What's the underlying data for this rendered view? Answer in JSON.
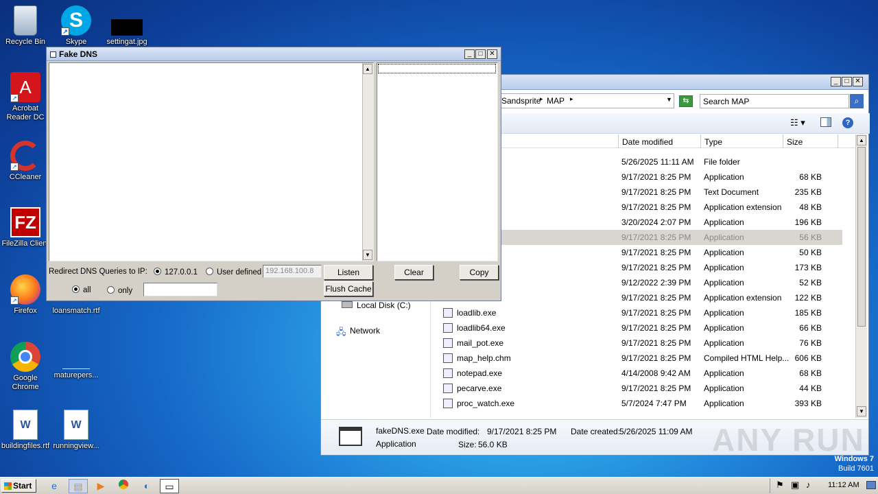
{
  "desktop_icons": [
    {
      "label": "Recycle Bin",
      "icon": "recycle-bin-icon"
    },
    {
      "label": "Skype",
      "icon": "skype-icon"
    },
    {
      "label": "settingat.jpg",
      "icon": "image-file-icon"
    },
    {
      "label": "Acrobat Reader DC",
      "icon": "acrobat-icon"
    },
    {
      "label": "CCleaner",
      "icon": "ccleaner-icon"
    },
    {
      "label": "FileZilla Client",
      "icon": "filezilla-icon"
    },
    {
      "label": "Firefox",
      "icon": "firefox-icon"
    },
    {
      "label": "loansmatch.rtf",
      "icon": "rtf-file-icon"
    },
    {
      "label": "Google Chrome",
      "icon": "chrome-icon"
    },
    {
      "label": "maturepers...",
      "icon": "file-icon"
    },
    {
      "label": "buildingfiles.rtf",
      "icon": "word-file-icon"
    },
    {
      "label": "runningview...",
      "icon": "word-file-icon"
    }
  ],
  "fake_dns": {
    "title": "Fake DNS",
    "redirect_label": "Redirect DNS Queries to IP:",
    "radio_localhost": "127.0.0.1",
    "radio_user": "User defined",
    "ip_placeholder": "192.168.100.8",
    "listen": "Listen",
    "clear": "Clear",
    "copy": "Copy",
    "flush": "Flush Cache",
    "radio_all": "all",
    "radio_only": "only",
    "only_value": ""
  },
  "explorer": {
    "breadcrumb_1": "Sandsprite",
    "breadcrumb_2": "MAP",
    "search_placeholder": "Search MAP",
    "columns": {
      "date": "Date modified",
      "type": "Type",
      "size": "Size"
    },
    "sidebar": {
      "local_disk": "Local Disk (C:)",
      "network": "Network"
    },
    "rows": [
      {
        "name": "",
        "date": "5/26/2025 11:11 AM",
        "type": "File folder",
        "size": ""
      },
      {
        "name": "",
        "date": "9/17/2021 8:25 PM",
        "type": "Application",
        "size": "68 KB"
      },
      {
        "name": "xt",
        "date": "9/17/2021 8:25 PM",
        "type": "Text Document",
        "size": "235 KB"
      },
      {
        "name": "",
        "date": "9/17/2021 8:25 PM",
        "type": "Application extension",
        "size": "48 KB"
      },
      {
        "name": "exe",
        "date": "3/20/2024 2:07 PM",
        "type": "Application",
        "size": "196 KB"
      },
      {
        "name": "",
        "date": "9/17/2021 8:25 PM",
        "type": "Application",
        "size": "56 KB"
      },
      {
        "name": "",
        "date": "9/17/2021 8:25 PM",
        "type": "Application",
        "size": "50 KB"
      },
      {
        "name": "",
        "date": "9/17/2021 8:25 PM",
        "type": "Application",
        "size": "173 KB"
      },
      {
        "name": "exe",
        "date": "9/12/2022 2:39 PM",
        "type": "Application",
        "size": "52 KB"
      },
      {
        "name": "",
        "date": "9/17/2021 8:25 PM",
        "type": "Application extension",
        "size": "122 KB"
      },
      {
        "name": "loadlib.exe",
        "date": "9/17/2021 8:25 PM",
        "type": "Application",
        "size": "185 KB"
      },
      {
        "name": "loadlib64.exe",
        "date": "9/17/2021 8:25 PM",
        "type": "Application",
        "size": "66 KB"
      },
      {
        "name": "mail_pot.exe",
        "date": "9/17/2021 8:25 PM",
        "type": "Application",
        "size": "76 KB"
      },
      {
        "name": "map_help.chm",
        "date": "9/17/2021 8:25 PM",
        "type": "Compiled HTML Help...",
        "size": "606 KB"
      },
      {
        "name": "notepad.exe",
        "date": "4/14/2008 9:42 AM",
        "type": "Application",
        "size": "68 KB"
      },
      {
        "name": "pecarve.exe",
        "date": "9/17/2021 8:25 PM",
        "type": "Application",
        "size": "44 KB"
      },
      {
        "name": "proc_watch.exe",
        "date": "5/7/2024 7:47 PM",
        "type": "Application",
        "size": "393 KB"
      }
    ],
    "details": {
      "name": "fakeDNS.exe",
      "type": "Application",
      "modified_label": "Date modified:",
      "modified": "9/17/2021 8:25 PM",
      "created_label": "Date created:",
      "created": "5/26/2025 11:09 AM",
      "size_label": "Size:",
      "size": "56.0 KB"
    }
  },
  "watermark": {
    "windows": "Windows 7",
    "build": "Build 7601",
    "anyrun": "ANY RUN"
  },
  "taskbar": {
    "start": "Start",
    "clock": "11:12 AM"
  }
}
